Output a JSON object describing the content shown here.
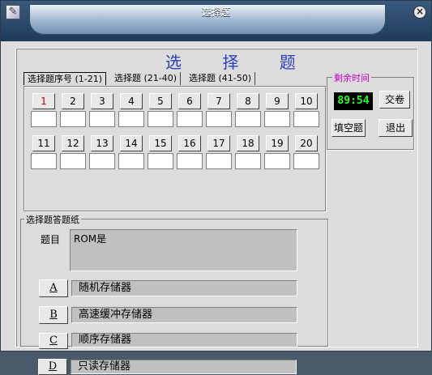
{
  "window": {
    "title": "选择题",
    "icon": "pen-icon",
    "close_icon": "close-icon"
  },
  "heading": "选 择 题",
  "tabs": [
    "选择题序号 (1-21)",
    "选择题 (21-40)",
    "选择题 (41-50)"
  ],
  "question_numbers": [
    "1",
    "2",
    "3",
    "4",
    "5",
    "6",
    "7",
    "8",
    "9",
    "10",
    "11",
    "12",
    "13",
    "14",
    "15",
    "16",
    "17",
    "18",
    "19",
    "20"
  ],
  "timer": {
    "legend": "剩余时间",
    "value": "89:54",
    "submit_label": "交卷"
  },
  "actions": {
    "fill_blank_label": "填空题",
    "exit_label": "退出"
  },
  "sheet": {
    "legend": "选择题答题纸",
    "question_label": "题目",
    "question_text": "ROM是",
    "options": [
      {
        "letter": "A",
        "text": "随机存储器"
      },
      {
        "letter": "B",
        "text": "高速缓冲存储器"
      },
      {
        "letter": "C",
        "text": "顺序存储器"
      },
      {
        "letter": "D",
        "text": "只读存储器"
      }
    ]
  },
  "colors": {
    "heading": "#2b3fb8",
    "timer_digits": "#22ff22",
    "timer_legend": "#c000c0",
    "active_number": "#c00000"
  }
}
